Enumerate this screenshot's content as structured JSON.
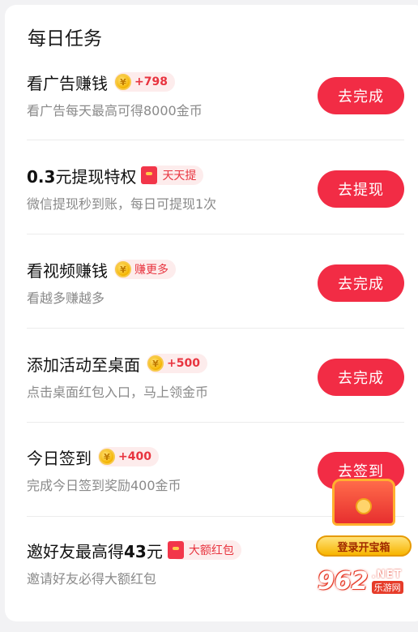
{
  "section_title": "每日任务",
  "tasks": [
    {
      "title": "看广告赚钱",
      "badge_type": "coin",
      "badge_text": "+798",
      "subtitle": "看广告每天最高可得8000金币",
      "button": "去完成"
    },
    {
      "title_bold": "0.3",
      "title": "元提现特权",
      "badge_type": "envelope",
      "badge_text": "天天提",
      "subtitle": "微信提现秒到账，每日可提现1次",
      "button": "去提现"
    },
    {
      "title": "看视频赚钱",
      "badge_type": "coin",
      "badge_text": "赚更多",
      "subtitle": "看越多赚越多",
      "button": "去完成"
    },
    {
      "title": "添加活动至桌面",
      "badge_type": "coin",
      "badge_text": "+500",
      "subtitle": "点击桌面红包入口，马上领金币",
      "button": "去完成"
    },
    {
      "title": "今日签到",
      "badge_type": "coin",
      "badge_text": "+400",
      "subtitle": "完成今日签到奖励400金币",
      "button": "去签到"
    },
    {
      "title": "邀好友最高得",
      "title_bold_suffix": "43",
      "title_end": "元",
      "badge_type": "envelope",
      "badge_text": "大额红包",
      "subtitle": "邀请好友必得大额红包",
      "button": ""
    }
  ],
  "coin_symbol": "¥",
  "treasure_chest": {
    "label": "登录开宝箱"
  },
  "watermark": {
    "logo": "962",
    "net": ".NET",
    "site": "乐游网"
  },
  "colors": {
    "accent": "#f22c45",
    "badge_text": "#e8343f",
    "badge_bg": "#fdecec",
    "coin": "#f4b400"
  }
}
